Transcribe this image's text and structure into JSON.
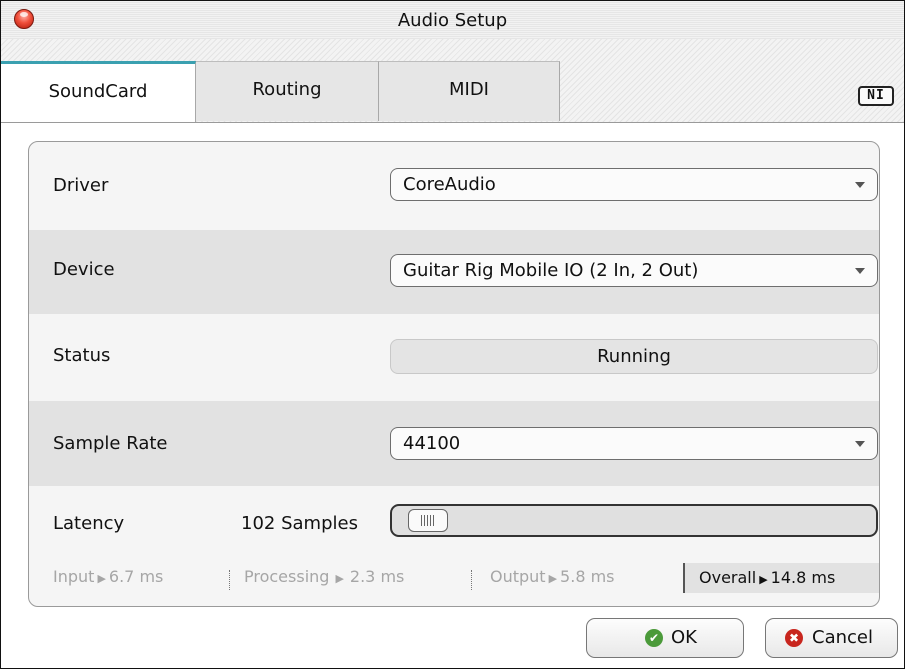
{
  "window": {
    "title": "Audio Setup"
  },
  "tabs": [
    {
      "label": "SoundCard",
      "active": true
    },
    {
      "label": "Routing",
      "active": false
    },
    {
      "label": "MIDI",
      "active": false
    }
  ],
  "logo": {
    "text": "NI",
    "icon": "ni-logo-icon"
  },
  "settings": {
    "driver": {
      "label": "Driver",
      "value": "CoreAudio"
    },
    "device": {
      "label": "Device",
      "value": "Guitar Rig Mobile IO (2 In, 2 Out)"
    },
    "status": {
      "label": "Status",
      "value": "Running"
    },
    "sample_rate": {
      "label": "Sample Rate",
      "value": "44100"
    },
    "latency": {
      "label": "Latency",
      "value": "102 Samples",
      "slider_fraction": 0.02
    }
  },
  "timings": {
    "input": {
      "label": "Input",
      "value": "6.7 ms"
    },
    "processing": {
      "label": "Processing",
      "value": "2.3 ms"
    },
    "output": {
      "label": "Output",
      "value": "5.8 ms"
    },
    "overall": {
      "label": "Overall",
      "value": "14.8 ms"
    },
    "arrow": "▶"
  },
  "buttons": {
    "ok": {
      "label": "OK",
      "icon": "check-icon",
      "icon_glyph": "✔",
      "color": "#4b9a3a"
    },
    "cancel": {
      "label": "Cancel",
      "icon": "x-icon",
      "icon_glyph": "✖",
      "color": "#c8261e"
    }
  },
  "colors": {
    "active_tab_accent": "#3aa0b0",
    "close_button": "#f0503c"
  }
}
